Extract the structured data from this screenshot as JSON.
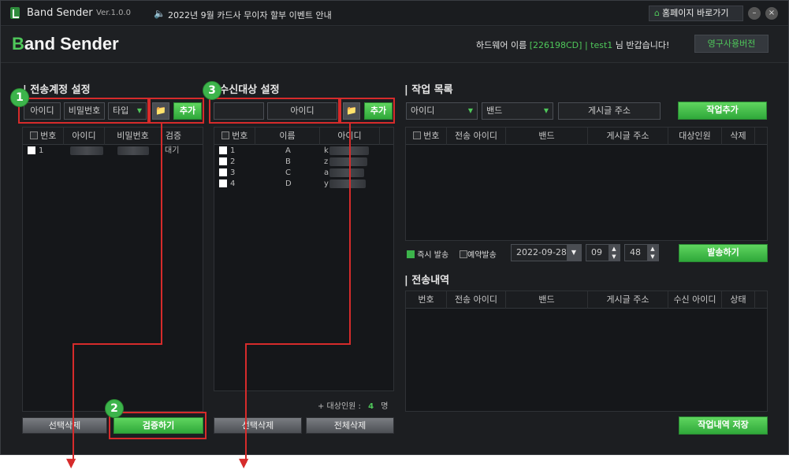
{
  "titlebar": {
    "app_name": "Band Sender",
    "version": "Ver.1.0.0",
    "notice": "2022년 9월 카드사 무이자 할부 이벤트 안내",
    "home_button": "홈페이지 바로가기",
    "minimize": "–",
    "close": "×"
  },
  "header": {
    "logo_b": "B",
    "logo_rest": "and Sender",
    "hw_prefix": "하드웨어 이름",
    "hw_id": "[226198CD]",
    "sep": "|",
    "user": "test1",
    "greeting": "님 반갑습니다!",
    "license_button": "영구사용버전"
  },
  "sender": {
    "title": "전송계정 설정",
    "id_field": "아이디",
    "pw_field": "비밀번호",
    "type_select": "타입",
    "add_button": "추가",
    "columns": [
      "번호",
      "아이디",
      "비밀번호",
      "검증"
    ],
    "rows": [
      {
        "num": "1",
        "status": "대기"
      }
    ],
    "delete_button": "선택삭제",
    "verify_button": "검증하기"
  },
  "receiver": {
    "title": "수신대상 설정",
    "id_field": "아이디",
    "add_button": "추가",
    "columns": [
      "번호",
      "이름",
      "아이디"
    ],
    "rows": [
      {
        "num": "1",
        "name": "A",
        "id": "k"
      },
      {
        "num": "2",
        "name": "B",
        "id": "z"
      },
      {
        "num": "3",
        "name": "C",
        "id": "a"
      },
      {
        "num": "4",
        "name": "D",
        "id": "y"
      }
    ],
    "count_label": "+ 대상인원 :",
    "count": "4",
    "count_unit": "명",
    "delete_button": "선택삭제",
    "delete_all_button": "전체삭제"
  },
  "jobs": {
    "title": "작업 목록",
    "id_select": "아이디",
    "band_select": "밴드",
    "post_url": "게시글 주소",
    "add_button": "작업추가",
    "columns": [
      "번호",
      "전송 아이디",
      "밴드",
      "게시글 주소",
      "대상인원",
      "삭제"
    ],
    "send_now": "즉시 발송",
    "reserve": "예약발송",
    "date": "2022-09-28",
    "hour": "09",
    "minute": "48",
    "send_button": "발송하기"
  },
  "history": {
    "title": "전송내역",
    "columns": [
      "번호",
      "전송 아이디",
      "밴드",
      "게시글 주소",
      "수신 아이디",
      "상태"
    ],
    "save_button": "작업내역 저장"
  },
  "annotations": [
    "1",
    "2",
    "3"
  ],
  "colors": {
    "accent": "#4fc75a",
    "annotation": "#d62b2b",
    "background": "#1c1e21"
  }
}
